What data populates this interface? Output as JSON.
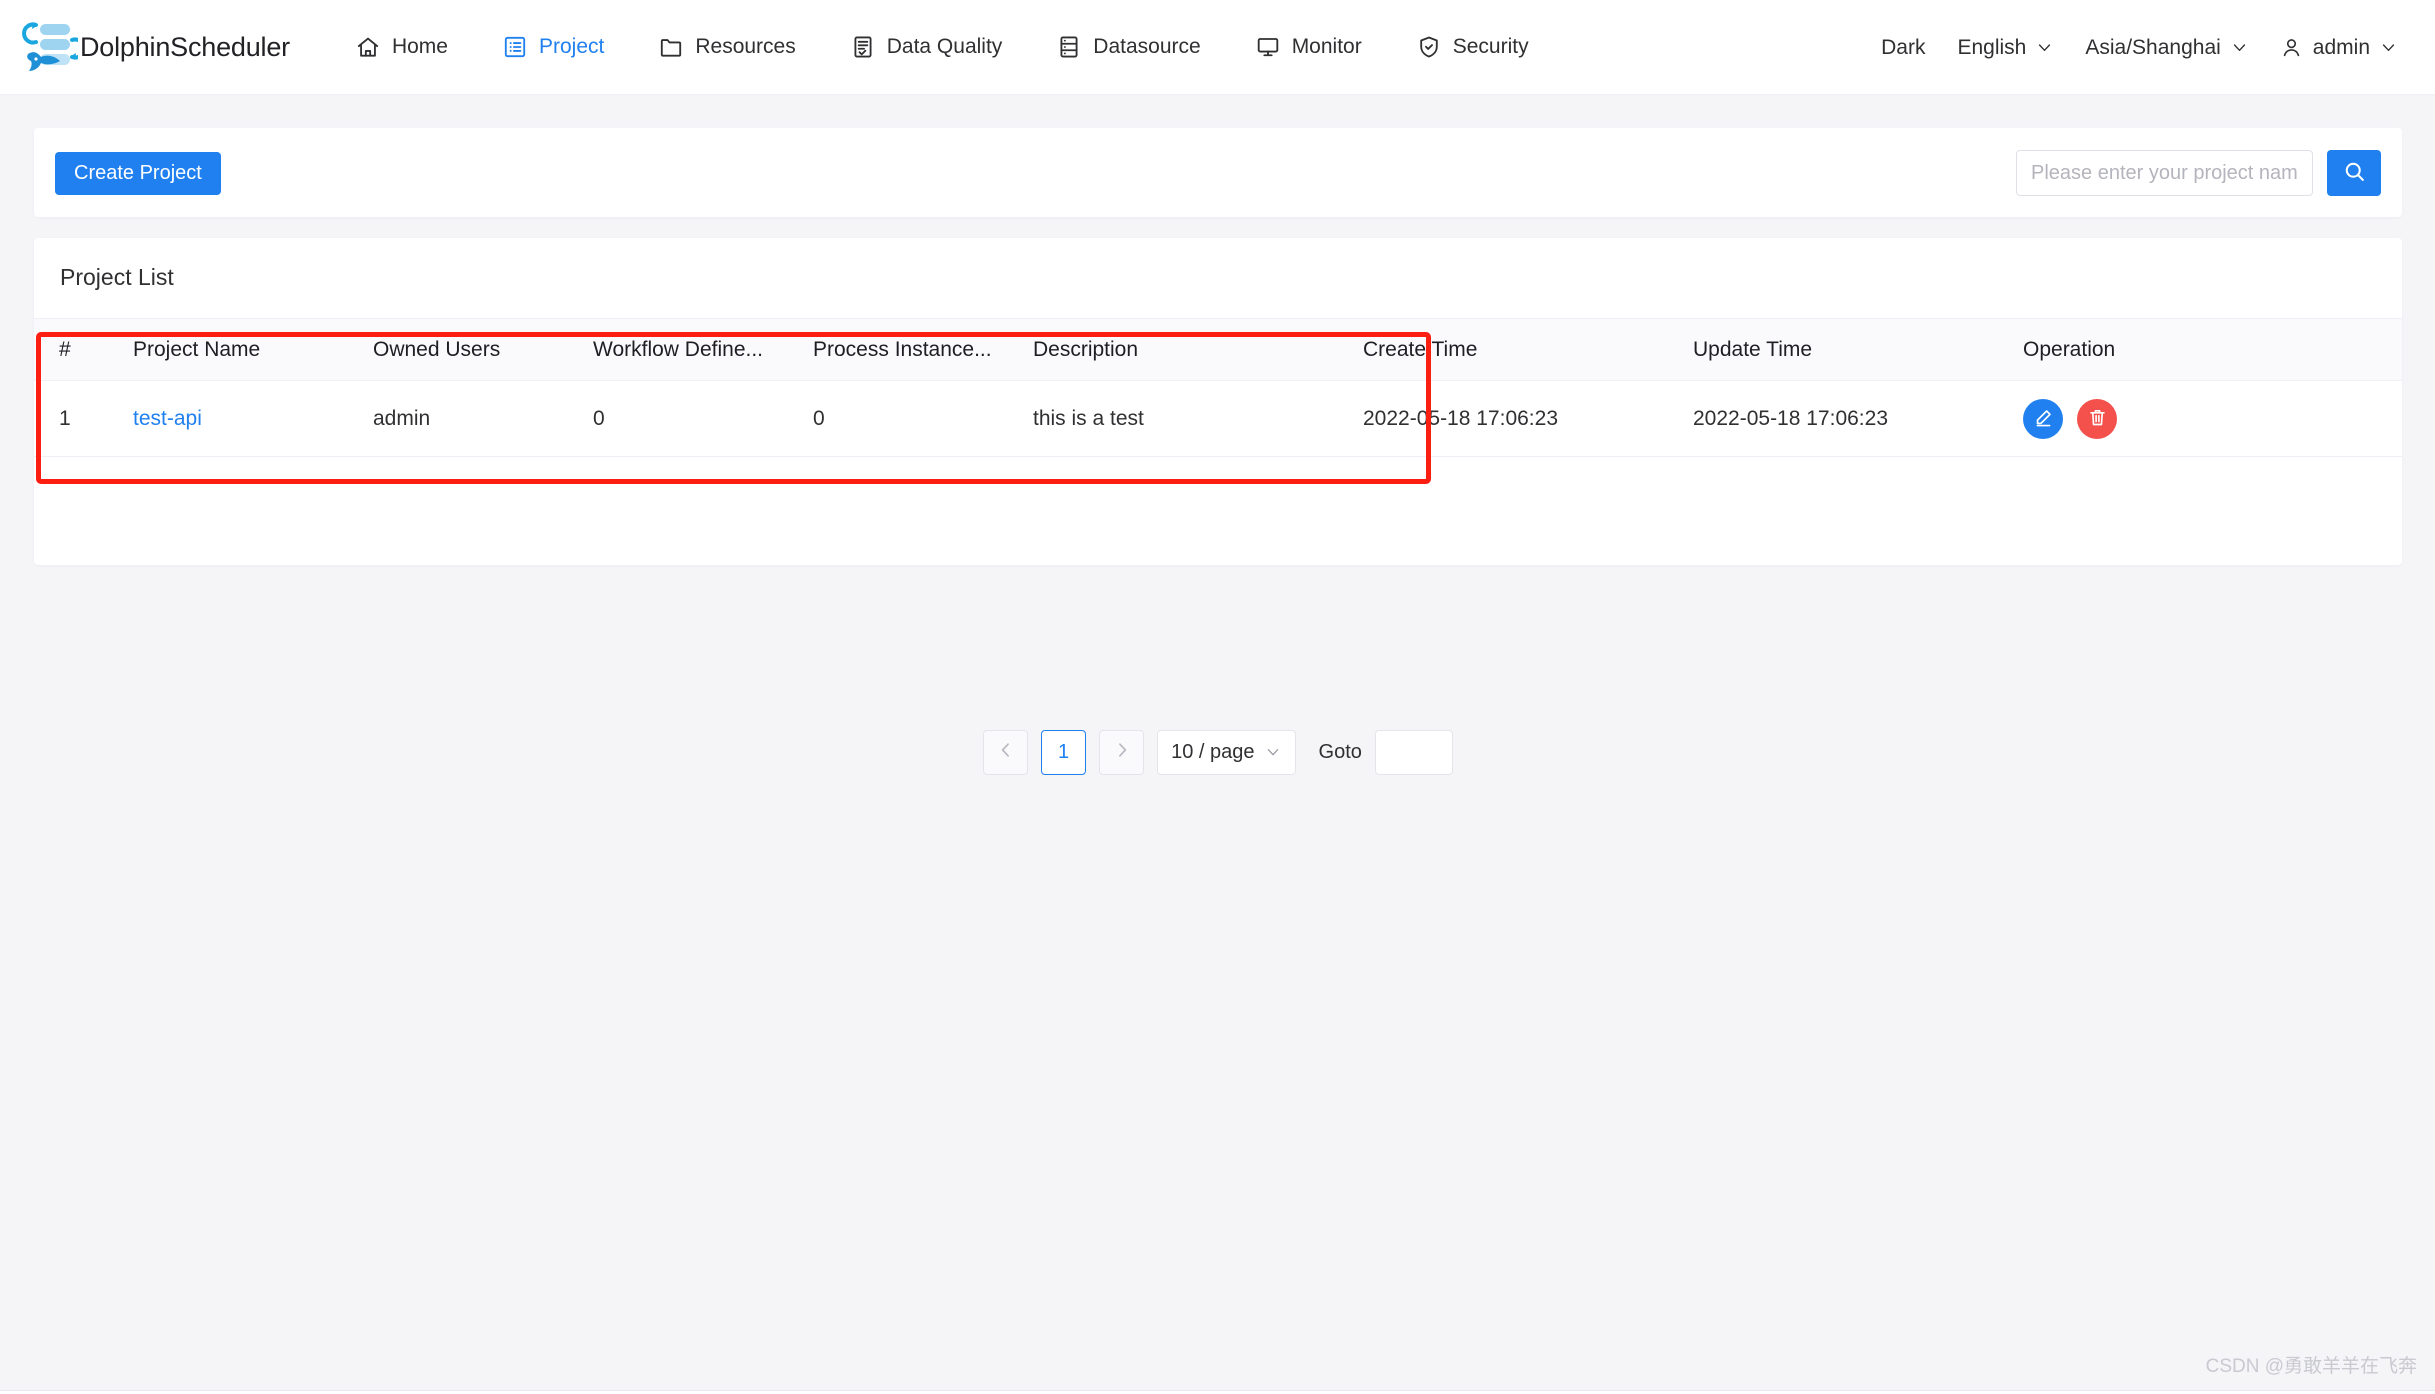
{
  "header": {
    "brand": "DolphinScheduler",
    "logo_icon": "dolphin-logo-icon",
    "nav": [
      {
        "label": "Home",
        "icon": "home-icon",
        "active": false
      },
      {
        "label": "Project",
        "icon": "project-list-icon",
        "active": true
      },
      {
        "label": "Resources",
        "icon": "folder-icon",
        "active": false
      },
      {
        "label": "Data Quality",
        "icon": "document-check-icon",
        "active": false
      },
      {
        "label": "Datasource",
        "icon": "database-icon",
        "active": false
      },
      {
        "label": "Monitor",
        "icon": "monitor-icon",
        "active": false
      },
      {
        "label": "Security",
        "icon": "shield-check-icon",
        "active": false
      }
    ],
    "theme_toggle": "Dark",
    "language": "English",
    "timezone": "Asia/Shanghai",
    "user": "admin",
    "user_icon": "user-icon",
    "chevron_icon": "chevron-down-icon"
  },
  "toolbar": {
    "create_label": "Create Project",
    "search_placeholder": "Please enter your project name",
    "search_value": "",
    "search_icon": "search-icon"
  },
  "list": {
    "title": "Project List",
    "columns": [
      "#",
      "Project Name",
      "Owned Users",
      "Workflow Define...",
      "Process Instance...",
      "Description",
      "Create Time",
      "Update Time",
      "Operation"
    ],
    "rows": [
      {
        "index": "1",
        "name": "test-api",
        "owned_users": "admin",
        "workflow_define_count": "0",
        "process_instance_count": "0",
        "description": "this is a test",
        "create_time": "2022-05-18 17:06:23",
        "update_time": "2022-05-18 17:06:23",
        "edit_icon": "edit-pencil-icon",
        "delete_icon": "trash-icon"
      }
    ]
  },
  "pagination": {
    "prev_icon": "chevron-left-icon",
    "next_icon": "chevron-right-icon",
    "current_page": "1",
    "page_size": "10 / page",
    "goto_label": "Goto",
    "goto_value": ""
  },
  "annotation": {
    "color": "#fb1e11"
  },
  "watermark": "CSDN @勇敢羊羊在飞奔",
  "colors": {
    "primary": "#2080f0",
    "danger": "#f4514d",
    "page_bg": "#f5f5f8",
    "card_bg": "#ffffff",
    "header_row_bg": "#fafafc"
  }
}
